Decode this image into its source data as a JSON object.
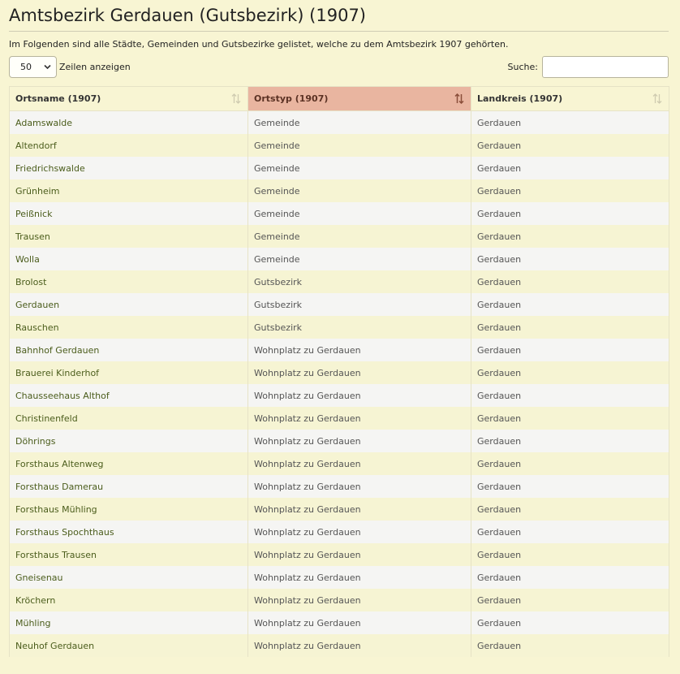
{
  "title": "Amtsbezirk Gerdauen (Gutsbezirk) (1907)",
  "intro": "Im Folgenden sind alle Städte, Gemeinden und Gutsbezirke gelistet, welche zu dem Amtsbezirk 1907 gehörten.",
  "controls": {
    "length_value": "50",
    "length_label": "Zeilen anzeigen",
    "search_label": "Suche:",
    "search_value": ""
  },
  "table": {
    "columns": [
      "Ortsname (1907)",
      "Ortstyp (1907)",
      "Landkreis (1907)"
    ],
    "sorted_column": 1,
    "rows": [
      [
        "Adamswalde",
        "Gemeinde",
        "Gerdauen"
      ],
      [
        "Altendorf",
        "Gemeinde",
        "Gerdauen"
      ],
      [
        "Friedrichswalde",
        "Gemeinde",
        "Gerdauen"
      ],
      [
        "Grünheim",
        "Gemeinde",
        "Gerdauen"
      ],
      [
        "Peißnick",
        "Gemeinde",
        "Gerdauen"
      ],
      [
        "Trausen",
        "Gemeinde",
        "Gerdauen"
      ],
      [
        "Wolla",
        "Gemeinde",
        "Gerdauen"
      ],
      [
        "Brolost",
        "Gutsbezirk",
        "Gerdauen"
      ],
      [
        "Gerdauen",
        "Gutsbezirk",
        "Gerdauen"
      ],
      [
        "Rauschen",
        "Gutsbezirk",
        "Gerdauen"
      ],
      [
        "Bahnhof Gerdauen",
        "Wohnplatz zu Gerdauen",
        "Gerdauen"
      ],
      [
        "Brauerei Kinderhof",
        "Wohnplatz zu Gerdauen",
        "Gerdauen"
      ],
      [
        "Chausseehaus Althof",
        "Wohnplatz zu Gerdauen",
        "Gerdauen"
      ],
      [
        "Christinenfeld",
        "Wohnplatz zu Gerdauen",
        "Gerdauen"
      ],
      [
        "Döhrings",
        "Wohnplatz zu Gerdauen",
        "Gerdauen"
      ],
      [
        "Forsthaus Altenweg",
        "Wohnplatz zu Gerdauen",
        "Gerdauen"
      ],
      [
        "Forsthaus Damerau",
        "Wohnplatz zu Gerdauen",
        "Gerdauen"
      ],
      [
        "Forsthaus Mühling",
        "Wohnplatz zu Gerdauen",
        "Gerdauen"
      ],
      [
        "Forsthaus Spochthaus",
        "Wohnplatz zu Gerdauen",
        "Gerdauen"
      ],
      [
        "Forsthaus Trausen",
        "Wohnplatz zu Gerdauen",
        "Gerdauen"
      ],
      [
        "Gneisenau",
        "Wohnplatz zu Gerdauen",
        "Gerdauen"
      ],
      [
        "Kröchern",
        "Wohnplatz zu Gerdauen",
        "Gerdauen"
      ],
      [
        "Mühling",
        "Wohnplatz zu Gerdauen",
        "Gerdauen"
      ],
      [
        "Neuhof Gerdauen",
        "Wohnplatz zu Gerdauen",
        "Gerdauen"
      ]
    ]
  },
  "icons": {
    "sort": "sort-icon",
    "sort_active": "sort-ascending-icon",
    "dropdown": "chevron-down-icon"
  },
  "colors": {
    "background": "#f8f5d3",
    "sorted_header": "#e9b5a0",
    "link_text": "#4b5d1c"
  }
}
